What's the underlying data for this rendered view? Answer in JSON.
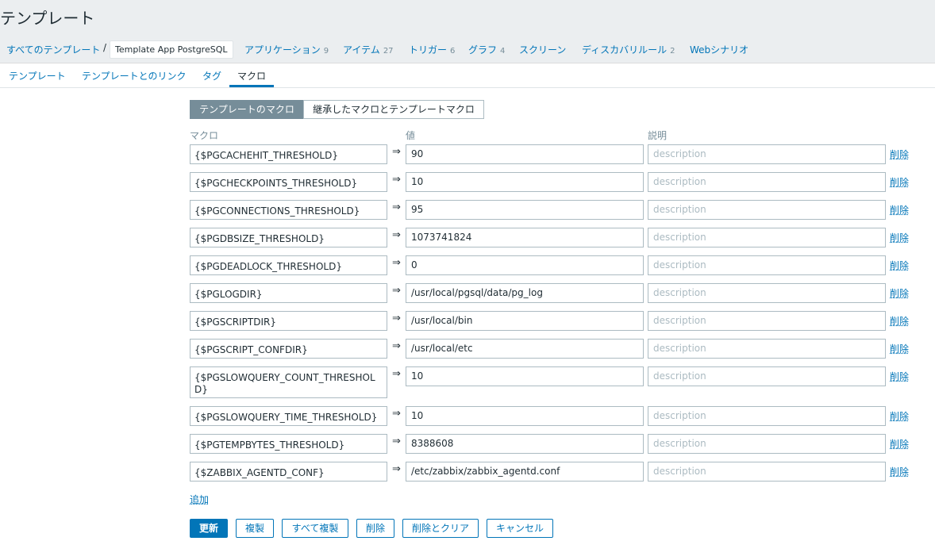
{
  "page": {
    "title": "テンプレート"
  },
  "breadcrumb": {
    "all_templates": "すべてのテンプレート",
    "separator": "/",
    "current": "Template App PostgreSQL",
    "links": [
      {
        "label": "アプリケーション",
        "count": "9"
      },
      {
        "label": "アイテム",
        "count": "27"
      },
      {
        "label": "トリガー",
        "count": "6"
      },
      {
        "label": "グラフ",
        "count": "4"
      },
      {
        "label": "スクリーン",
        "count": ""
      },
      {
        "label": "ディスカバリルール",
        "count": "2"
      },
      {
        "label": "Webシナリオ",
        "count": ""
      }
    ]
  },
  "tabs": [
    {
      "label": "テンプレート"
    },
    {
      "label": "テンプレートとのリンク"
    },
    {
      "label": "タグ"
    },
    {
      "label": "マクロ",
      "active": true
    }
  ],
  "segment": {
    "template_macros": "テンプレートのマクロ",
    "inherited_macros": "継承したマクロとテンプレートマクロ"
  },
  "columns": {
    "macro": "マクロ",
    "value": "値",
    "description": "説明"
  },
  "macros": [
    {
      "macro": "{$PGCACHEHIT_THRESHOLD}",
      "value": "90",
      "description_placeholder": "description",
      "remove": "削除"
    },
    {
      "macro": "{$PGCHECKPOINTS_THRESHOLD}",
      "value": "10",
      "description_placeholder": "description",
      "remove": "削除"
    },
    {
      "macro": "{$PGCONNECTIONS_THRESHOLD}",
      "value": "95",
      "description_placeholder": "description",
      "remove": "削除"
    },
    {
      "macro": "{$PGDBSIZE_THRESHOLD}",
      "value": "1073741824",
      "description_placeholder": "description",
      "remove": "削除"
    },
    {
      "macro": "{$PGDEADLOCK_THRESHOLD}",
      "value": "0",
      "description_placeholder": "description",
      "remove": "削除"
    },
    {
      "macro": "{$PGLOGDIR}",
      "value": "/usr/local/pgsql/data/pg_log",
      "description_placeholder": "description",
      "remove": "削除"
    },
    {
      "macro": "{$PGSCRIPTDIR}",
      "value": "/usr/local/bin",
      "description_placeholder": "description",
      "remove": "削除"
    },
    {
      "macro": "{$PGSCRIPT_CONFDIR}",
      "value": "/usr/local/etc",
      "description_placeholder": "description",
      "remove": "削除"
    },
    {
      "macro": "{$PGSLOWQUERY_COUNT_THRESHOLD}",
      "value": "10",
      "description_placeholder": "description",
      "remove": "削除"
    },
    {
      "macro": "{$PGSLOWQUERY_TIME_THRESHOLD}",
      "value": "10",
      "description_placeholder": "description",
      "remove": "削除"
    },
    {
      "macro": "{$PGTEMPBYTES_THRESHOLD}",
      "value": "8388608",
      "description_placeholder": "description",
      "remove": "削除"
    },
    {
      "macro": "{$ZABBIX_AGENTD_CONF}",
      "value": "/etc/zabbix/zabbix_agentd.conf",
      "description_placeholder": "description",
      "remove": "削除"
    }
  ],
  "add_label": "追加",
  "buttons": {
    "update": "更新",
    "clone": "複製",
    "full_clone": "すべて複製",
    "delete": "削除",
    "delete_and_clear": "削除とクリア",
    "cancel": "キャンセル"
  },
  "colors": {
    "link": "#0275b8",
    "header_bg": "#ebeef0",
    "segment_active": "#768d99"
  },
  "icons": {
    "arrow": "double-arrow-right-icon"
  }
}
